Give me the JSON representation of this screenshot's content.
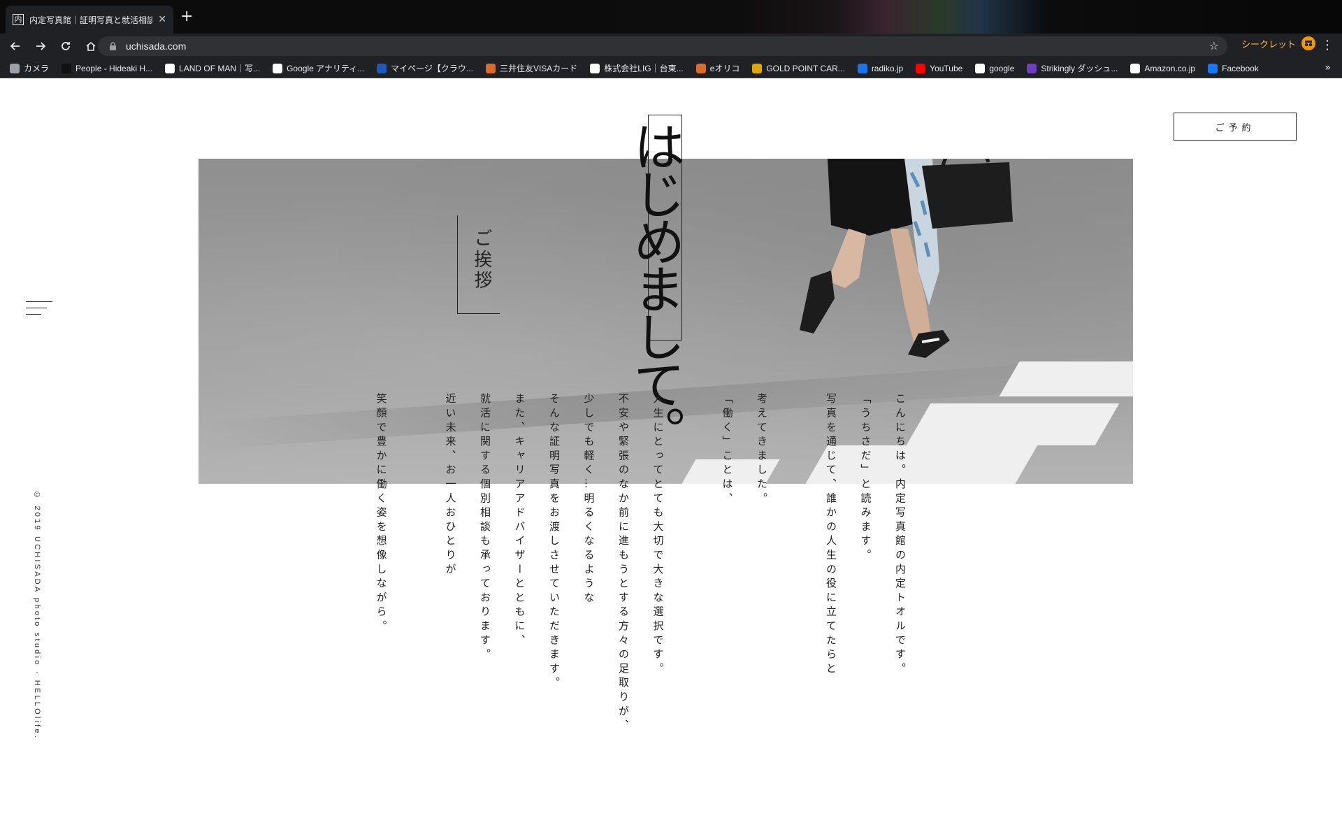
{
  "browser": {
    "tab_title": "内定写真館｜証明写真と就活相談",
    "tab_favicon": "内",
    "tab_close": "✕",
    "new_tab": "+",
    "url": "uchisada.com",
    "incognito_label": "シークレット",
    "bookmarks": [
      {
        "label": "カメラ",
        "icon": "folder-icon",
        "color": "#9aa0a6"
      },
      {
        "label": "People - Hideaki H...",
        "icon": "people-icon",
        "color": "#111111"
      },
      {
        "label": "LAND OF MAN｜写...",
        "icon": "page-icon",
        "color": "#ffffff"
      },
      {
        "label": "Google アナリティ...",
        "icon": "google-icon",
        "color": "#ffffff"
      },
      {
        "label": "マイページ【クラウ...",
        "icon": "cw-icon",
        "color": "#1e5bb8"
      },
      {
        "label": "三井住友VISAカード",
        "icon": "orico-icon",
        "color": "#d96b2b"
      },
      {
        "label": "株式会社LIG｜台東...",
        "icon": "lig-icon",
        "color": "#ffffff"
      },
      {
        "label": "eオリコ",
        "icon": "orico-icon",
        "color": "#d96b2b"
      },
      {
        "label": "GOLD POINT CAR...",
        "icon": "grid-icon",
        "color": "#e0a800"
      },
      {
        "label": "radiko.jp",
        "icon": "radiko-icon",
        "color": "#1a73e8"
      },
      {
        "label": "YouTube",
        "icon": "youtube-icon",
        "color": "#ff0000"
      },
      {
        "label": "google",
        "icon": "google-icon",
        "color": "#ffffff"
      },
      {
        "label": "Strikingly ダッシュ...",
        "icon": "strikingly-icon",
        "color": "#6c3ec1"
      },
      {
        "label": "Amazon.co.jp",
        "icon": "amazon-icon",
        "color": "#ffffff"
      },
      {
        "label": "Facebook",
        "icon": "facebook-icon",
        "color": "#1877f2"
      }
    ]
  },
  "site": {
    "reserve_button": "ご予約",
    "copyright": "© 2019 UCHISADA photo studio · HELLOlife.",
    "greeting_label": "ご挨拶",
    "title": "はじめまして。",
    "paragraphs": [
      [
        "こんにちは。内定写真館の内定トオルです。",
        "「うちさだ」と読みます。"
      ],
      [
        "写真を通じて、誰かの人生の役に立てたらと",
        "考えてきました。"
      ],
      [
        "「働く」ことは、",
        "人生にとってとても大切で大きな選択です。",
        "不安や緊張のなか前に進もうとする方々の足取りが、",
        "少しでも軽く…明るくなるような",
        "そんな証明写真をお渡しさせていただきます。",
        "また、キャリアアドバイザーとともに、",
        "就活に関する個別相談も承っております。"
      ],
      [
        "近い未来、お一人おひとりが",
        "笑顔で豊かに働く姿を想像しながら。"
      ]
    ]
  },
  "colors": {
    "chrome_bg": "#202124",
    "omnibox_bg": "#303134",
    "incognito_accent": "#ffb74d",
    "text": "#222222"
  }
}
